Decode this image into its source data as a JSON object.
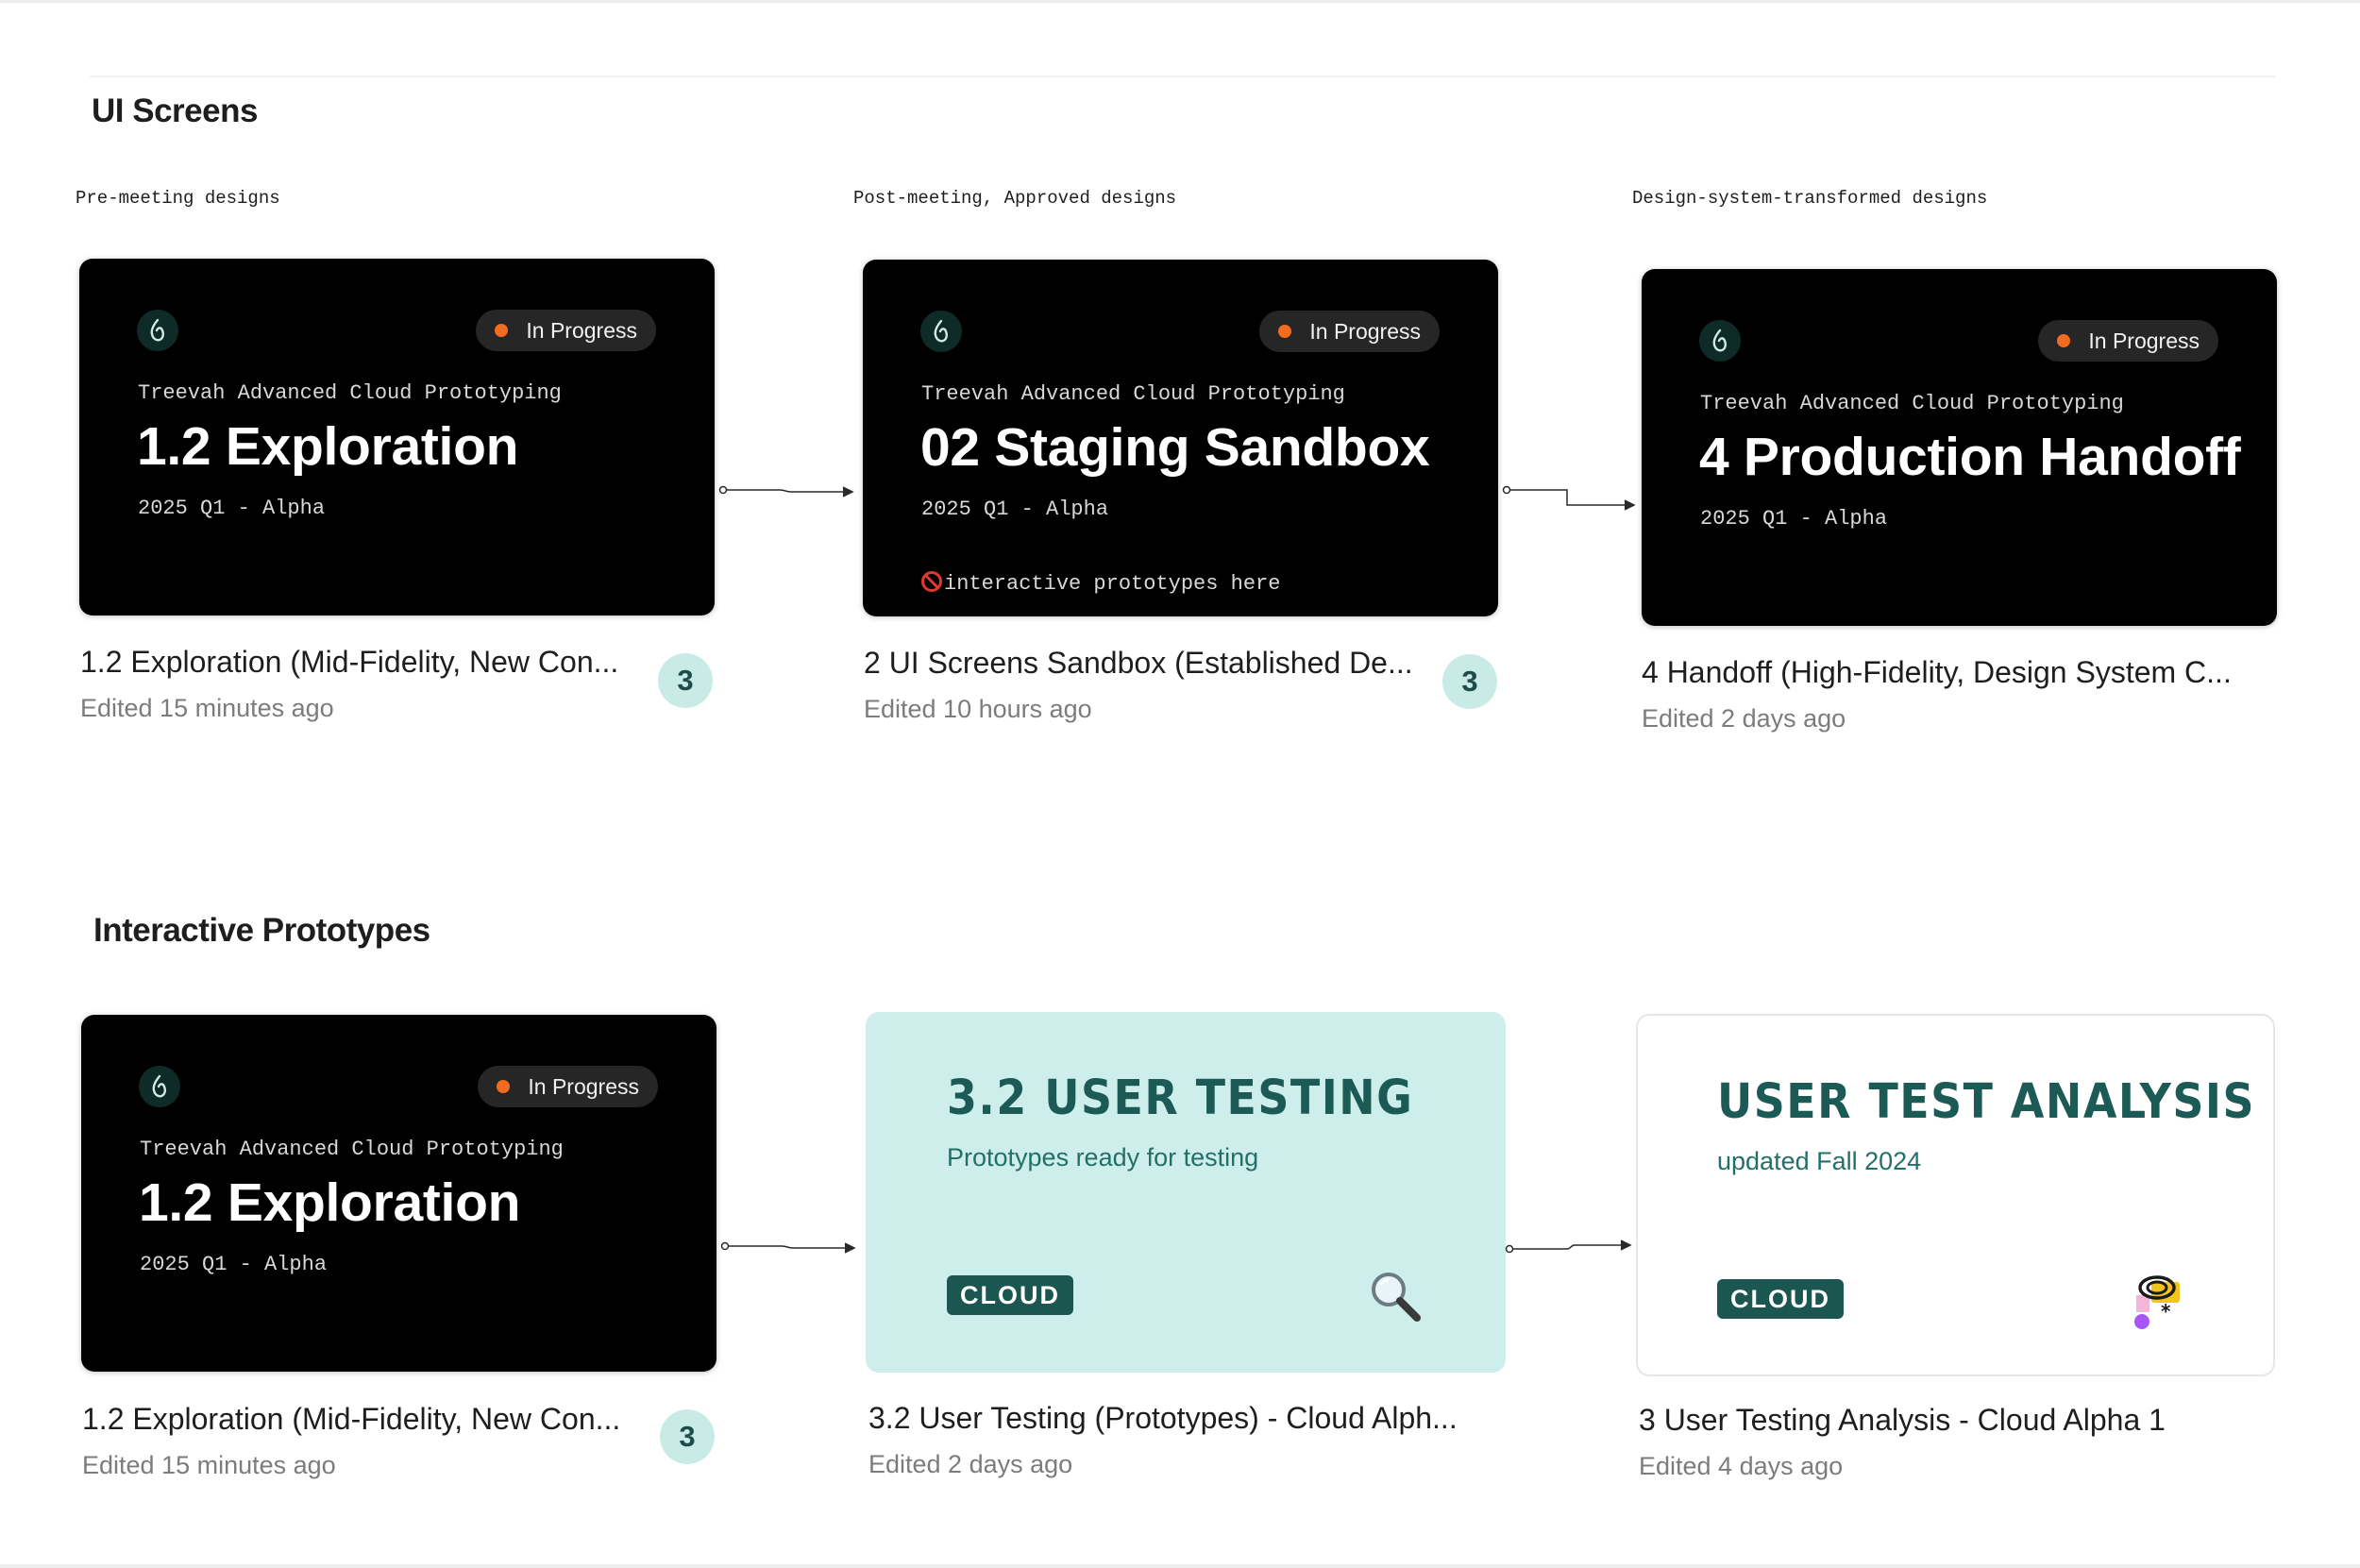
{
  "sections": [
    {
      "title": "UI Screens",
      "columns": [
        "Pre-meeting designs",
        "Post-meeting, Approved designs",
        "Design-system-transformed designs"
      ],
      "cards": [
        {
          "badge": "In Progress",
          "subtitle": "Treevah Advanced Cloud Prototyping",
          "title": "1.2 Exploration",
          "meta": "2025 Q1 - Alpha",
          "name": "1.2 Exploration (Mid-Fidelity, New Con...",
          "edited": "Edited 15 minutes ago",
          "count": "3"
        },
        {
          "badge": "In Progress",
          "subtitle": "Treevah Advanced Cloud Prototyping",
          "title": "02 Staging Sandbox",
          "meta": "2025 Q1 - Alpha",
          "note": "interactive prototypes here",
          "name": "2 UI Screens Sandbox (Established De...",
          "edited": "Edited 10 hours ago",
          "count": "3"
        },
        {
          "badge": "In Progress",
          "subtitle": "Treevah Advanced Cloud Prototyping",
          "title": "4 Production Handoff",
          "meta": "2025 Q1 - Alpha",
          "name": "4 Handoff (High-Fidelity, Design System C...",
          "edited": "Edited 2 days ago"
        }
      ]
    },
    {
      "title": "Interactive Prototypes",
      "cards": [
        {
          "badge": "In Progress",
          "subtitle": "Treevah Advanced Cloud Prototyping",
          "title": "1.2 Exploration",
          "meta": "2025 Q1 - Alpha",
          "name": "1.2 Exploration (Mid-Fidelity, New Con...",
          "edited": "Edited 15 minutes ago",
          "count": "3"
        },
        {
          "title": "3.2 USER TESTING",
          "subtitle": "Prototypes ready for testing",
          "tag": "CLOUD",
          "icon": "magnifying-glass-icon",
          "name": "3.2 User Testing (Prototypes) - Cloud Alph...",
          "edited": "Edited 2 days ago"
        },
        {
          "title": "USER TEST ANALYSIS",
          "subtitle": "updated Fall 2024",
          "tag": "CLOUD",
          "icon": "analysis-sticker-icon",
          "name": "3 User Testing Analysis - Cloud Alpha 1",
          "edited": "Edited 4 days ago"
        }
      ]
    }
  ],
  "colors": {
    "accent_dot": "#f26b21",
    "brand_teal": "#1b5a55",
    "teal_card": "#cdeeea",
    "count_badge": "#c9ebe6"
  }
}
